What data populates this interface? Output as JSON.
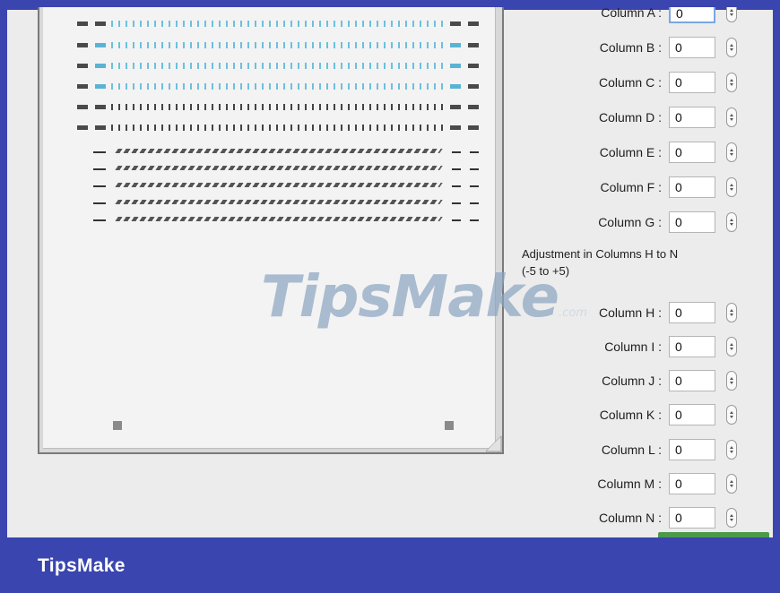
{
  "watermark": {
    "brand": "TipsMake",
    "suffix": ".com"
  },
  "section_heading": "Adjustment in Columns H to N\n(-5 to +5)",
  "columns_a_to_g": [
    {
      "label": "Column A :",
      "value": "0"
    },
    {
      "label": "Column B :",
      "value": "0"
    },
    {
      "label": "Column C :",
      "value": "0"
    },
    {
      "label": "Column D :",
      "value": "0"
    },
    {
      "label": "Column E :",
      "value": "0"
    },
    {
      "label": "Column F :",
      "value": "0"
    },
    {
      "label": "Column G :",
      "value": "0"
    }
  ],
  "columns_h_to_n": [
    {
      "label": "Column H :",
      "value": "0"
    },
    {
      "label": "Column I :",
      "value": "0"
    },
    {
      "label": "Column J :",
      "value": "0"
    },
    {
      "label": "Column K :",
      "value": "0"
    },
    {
      "label": "Column L :",
      "value": "0"
    },
    {
      "label": "Column M :",
      "value": "0"
    },
    {
      "label": "Column N :",
      "value": "0"
    }
  ],
  "footer": {
    "brand": "TipsMake"
  },
  "colors": {
    "frame_blue": "#3a45b0",
    "preview_blue": "#5ab3d4",
    "focus_ring": "#7aa7e0",
    "button_green": "#4a9a4a"
  },
  "icons": [
    "stepper-icon",
    "resize-grip-icon"
  ]
}
